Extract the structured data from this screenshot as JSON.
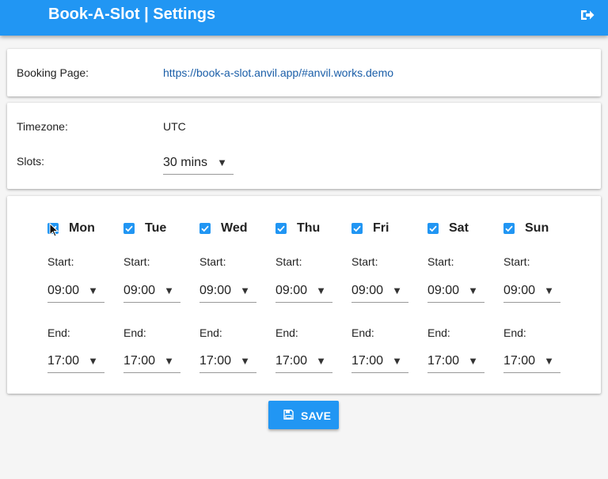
{
  "header": {
    "title": "Book-A-Slot | Settings",
    "logout_icon": "sign-out-icon",
    "background_color": "#2196f3"
  },
  "booking": {
    "label": "Booking Page:",
    "url": "https://book-a-slot.anvil.app/#anvil.works.demo"
  },
  "settings": {
    "timezone_label": "Timezone:",
    "timezone_value": "UTC",
    "slots_label": "Slots:",
    "slots_value": "30 mins"
  },
  "schedule": {
    "start_label": "Start:",
    "end_label": "End:",
    "days": [
      {
        "name": "Mon",
        "checked": true,
        "start": "09:00",
        "end": "17:00"
      },
      {
        "name": "Tue",
        "checked": true,
        "start": "09:00",
        "end": "17:00"
      },
      {
        "name": "Wed",
        "checked": true,
        "start": "09:00",
        "end": "17:00"
      },
      {
        "name": "Thu",
        "checked": true,
        "start": "09:00",
        "end": "17:00"
      },
      {
        "name": "Fri",
        "checked": true,
        "start": "09:00",
        "end": "17:00"
      },
      {
        "name": "Sat",
        "checked": true,
        "start": "09:00",
        "end": "17:00"
      },
      {
        "name": "Sun",
        "checked": true,
        "start": "09:00",
        "end": "17:00"
      }
    ]
  },
  "actions": {
    "save_label": "SAVE",
    "save_icon": "floppy-disk-icon"
  }
}
